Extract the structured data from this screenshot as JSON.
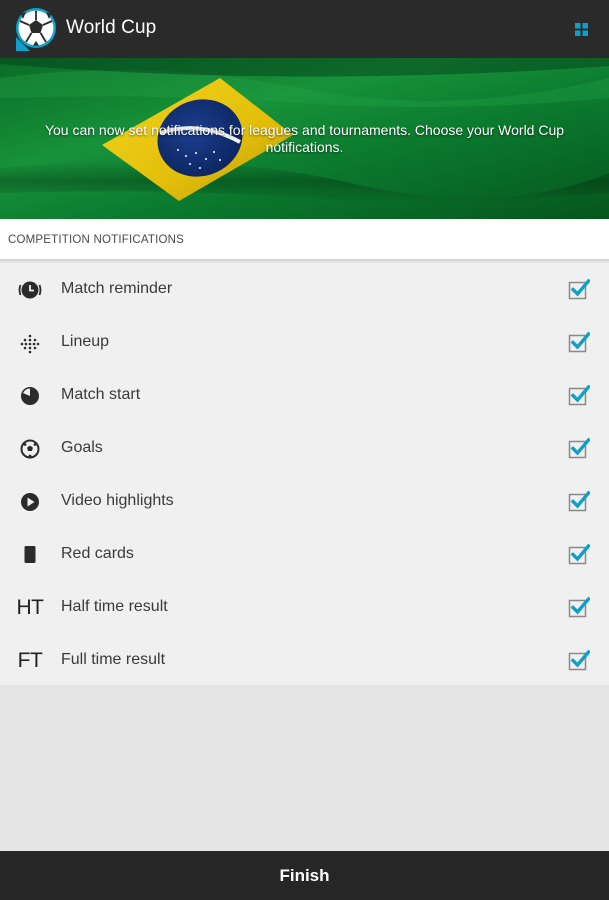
{
  "action_bar": {
    "title": "World Cup",
    "logo_icon": "soccer-ball-logo",
    "menu_icon": "grid-icon",
    "accent_color": "#0fa0c8"
  },
  "banner": {
    "text": "You can now set notifications for leagues and tournaments. Choose your World Cup notifications.",
    "image": "brazil-flag"
  },
  "section": {
    "title": "COMPETITION NOTIFICATIONS"
  },
  "notifications": [
    {
      "icon": "clock-alarm-icon",
      "label": "Match reminder",
      "checked": true
    },
    {
      "icon": "lineup-icon",
      "label": "Lineup",
      "checked": true
    },
    {
      "icon": "match-start-icon",
      "label": "Match start",
      "checked": true
    },
    {
      "icon": "goal-ball-icon",
      "label": "Goals",
      "checked": true
    },
    {
      "icon": "play-icon",
      "label": "Video highlights",
      "checked": true
    },
    {
      "icon": "red-card-icon",
      "label": "Red cards",
      "checked": true
    },
    {
      "icon_text": "HT",
      "label": "Half time result",
      "checked": true
    },
    {
      "icon_text": "FT",
      "label": "Full time result",
      "checked": true
    }
  ],
  "footer": {
    "finish_label": "Finish"
  }
}
